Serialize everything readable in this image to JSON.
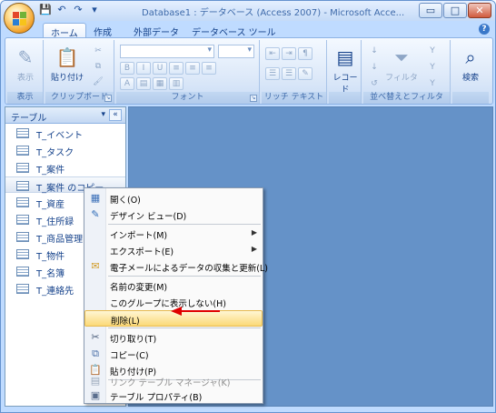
{
  "window": {
    "title": "Database1 : データベース (Access 2007) - Microsoft Acce...",
    "controls": {
      "minimize": "▭",
      "maximize": "□",
      "close": "✕"
    }
  },
  "qat": {
    "save": "💾",
    "undo": "↶",
    "redo": "↷",
    "more": "▾"
  },
  "tabs": [
    {
      "label": "ホーム",
      "active": true
    },
    {
      "label": "作成"
    },
    {
      "label": "外部データ"
    },
    {
      "label": "データベース ツール"
    }
  ],
  "ribbon": {
    "groups": {
      "view": {
        "label": "表示",
        "button": "表示"
      },
      "clipboard": {
        "label": "クリップボード",
        "paste": "貼り付け"
      },
      "font": {
        "label": "フォント"
      },
      "richtext": {
        "label": "リッチ テキスト"
      },
      "records": {
        "button": "レコード"
      },
      "sortfilter": {
        "label": "並べ替えとフィルタ",
        "filter": "フィルタ"
      },
      "find": {
        "button": "検索"
      }
    }
  },
  "nav": {
    "title": "テーブル",
    "collapse": "«",
    "items": [
      {
        "label": "T_イベント"
      },
      {
        "label": "T_タスク"
      },
      {
        "label": "T_案件"
      },
      {
        "label": "T_案件 のコピー",
        "selected": true
      },
      {
        "label": "T_資産"
      },
      {
        "label": "T_住所録"
      },
      {
        "label": "T_商品管理"
      },
      {
        "label": "T_物件"
      },
      {
        "label": "T_名簿"
      },
      {
        "label": "T_連絡先"
      }
    ]
  },
  "context_menu": {
    "items": [
      {
        "label": "開く(O)",
        "icon": "open-icon"
      },
      {
        "label": "デザイン ビュー(D)",
        "icon": "design-view-icon"
      },
      {
        "label": "インポート(M)",
        "submenu": true
      },
      {
        "label": "エクスポート(E)",
        "submenu": true
      },
      {
        "label": "電子メールによるデータの収集と更新(L)",
        "icon": "email-icon"
      },
      {
        "label": "名前の変更(M)"
      },
      {
        "label": "このグループに表示しない(H)"
      },
      {
        "label": "削除(L)",
        "highlighted": true
      },
      {
        "label": "切り取り(T)",
        "icon": "scissors-icon"
      },
      {
        "label": "コピー(C)",
        "icon": "copy-icon"
      },
      {
        "label": "貼り付け(P)",
        "icon": "paste-icon"
      },
      {
        "label": "リンク テーブル マネージャ(K)",
        "disabled": true,
        "icon": "link-table-icon"
      },
      {
        "label": "テーブル プロパティ(B)",
        "icon": "properties-icon"
      }
    ]
  },
  "colors": {
    "accent": "#15428b",
    "workspace": "#6592c8",
    "highlight": "#fbd977",
    "annotation_arrow": "#e00000"
  }
}
